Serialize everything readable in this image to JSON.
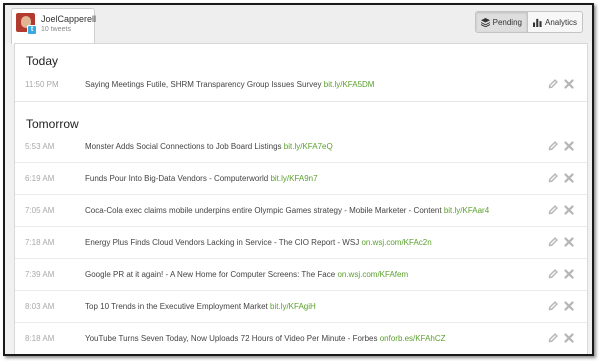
{
  "account": {
    "name": "JoelCapperell",
    "count": "10 tweets"
  },
  "view_toggle": {
    "pending_label": "Pending",
    "analytics_label": "Analytics"
  },
  "sections": [
    {
      "heading": "Today",
      "tweets": [
        {
          "time": "11:50 PM",
          "text": "Saying Meetings Futile, SHRM Transparency Group Issues Survey",
          "link": "bit.ly/KFA5DM"
        }
      ]
    },
    {
      "heading": "Tomorrow",
      "tweets": [
        {
          "time": "5:53 AM",
          "text": "Monster Adds Social Connections to Job Board Listings",
          "link": "bit.ly/KFA7eQ"
        },
        {
          "time": "6:19 AM",
          "text": "Funds Pour Into Big-Data Vendors - Computerworld",
          "link": "bit.ly/KFA9n7"
        },
        {
          "time": "7:05 AM",
          "text": "Coca-Cola exec claims mobile underpins entire Olympic Games strategy - Mobile Marketer - Content",
          "link": "bit.ly/KFAar4"
        },
        {
          "time": "7:18 AM",
          "text": "Energy Plus Finds Cloud Vendors Lacking in Service - The CIO Report - WSJ",
          "link": "on.wsj.com/KFAc2n"
        },
        {
          "time": "7:39 AM",
          "text": "Google PR at it again! - A New Home for Computer Screens: The Face",
          "link": "on.wsj.com/KFAfem"
        },
        {
          "time": "8:03 AM",
          "text": "Top 10 Trends in the Executive Employment Market",
          "link": "bit.ly/KFAgiH"
        },
        {
          "time": "8:18 AM",
          "text": "YouTube Turns Seven Today, Now Uploads 72 Hours of Video Per Minute - Forbes",
          "link": "onforb.es/KFAhCZ"
        }
      ]
    }
  ],
  "icons": {
    "edit": "pencil-icon",
    "delete": "close-icon",
    "pending": "stack-icon",
    "analytics": "bar-chart-icon"
  },
  "colors": {
    "link": "#5aa02c",
    "twitter": "#39a9e0"
  }
}
